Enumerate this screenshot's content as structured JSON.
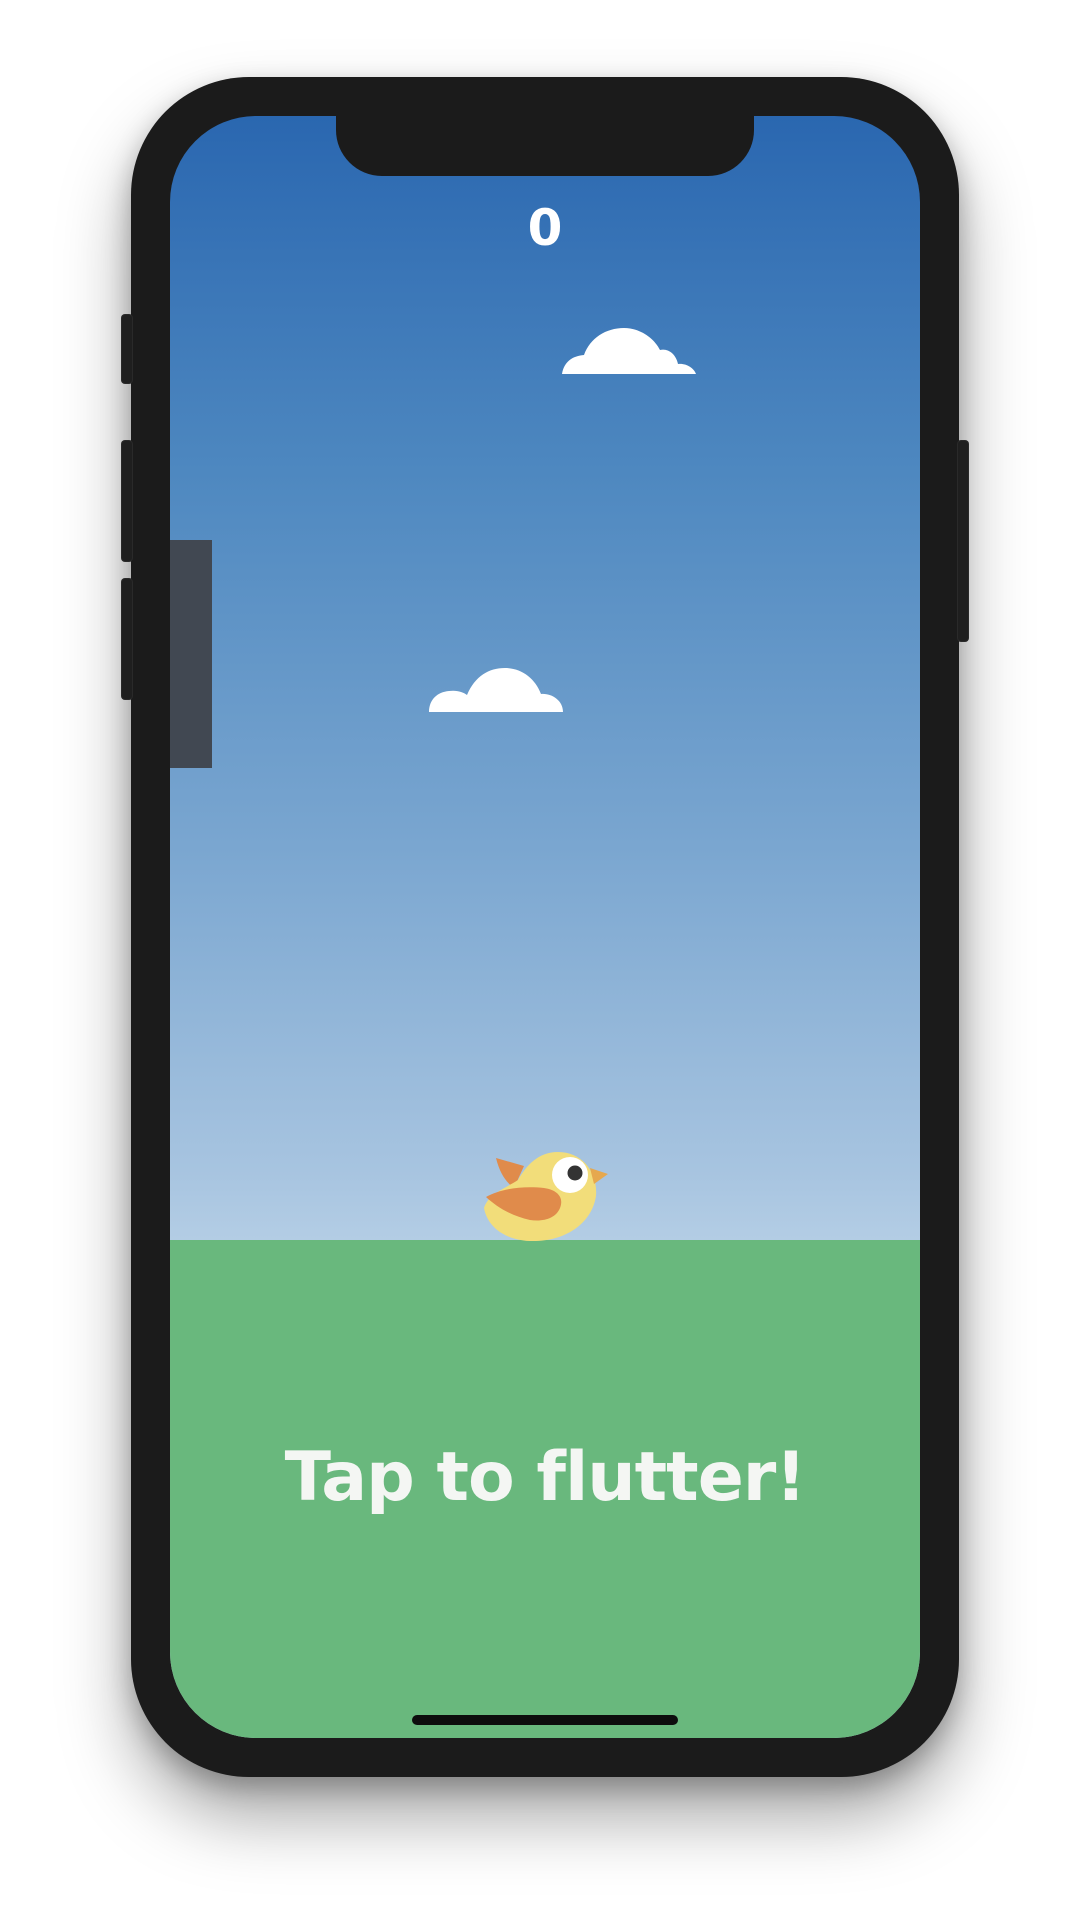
{
  "game": {
    "score": "0",
    "prompt": "Tap to flutter!"
  },
  "colors": {
    "sky_top": "#2a67b0",
    "sky_bottom": "#c2d8ea",
    "ground": "#69b87d",
    "pipe": "#414852",
    "bird_body": "#f2dd7a",
    "bird_wing": "#e08b4b",
    "text": "#ffffff"
  },
  "icons": {
    "bird": "bird-icon",
    "cloud": "cloud-icon"
  }
}
